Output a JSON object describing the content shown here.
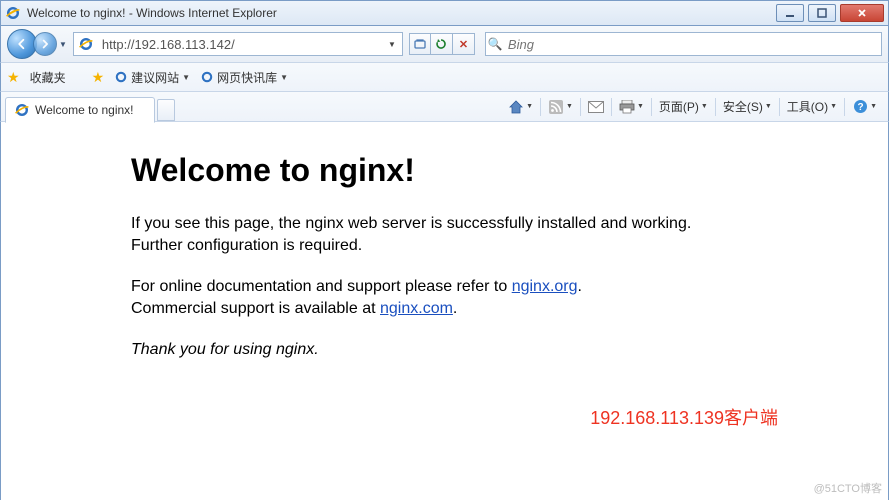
{
  "window": {
    "title": "Welcome to nginx! - Windows Internet Explorer"
  },
  "nav": {
    "url": "http://192.168.113.142/",
    "search_placeholder": "Bing"
  },
  "favorites": {
    "label": "收藏夹",
    "items": [
      {
        "label": "建议网站"
      },
      {
        "label": "网页快讯库"
      }
    ]
  },
  "tab": {
    "title": "Welcome to nginx!"
  },
  "commands": {
    "page": "页面(P)",
    "safety": "安全(S)",
    "tools": "工具(O)"
  },
  "page": {
    "heading": "Welcome to nginx!",
    "p1": "If you see this page, the nginx web server is successfully installed and working. Further configuration is required.",
    "p2a": "For online documentation and support please refer to ",
    "p2link": "nginx.org",
    "p2b": ".",
    "p3a": "Commercial support is available at ",
    "p3link": "nginx.com",
    "p3b": ".",
    "thanks": "Thank you for using nginx."
  },
  "annotation": "192.168.113.139客户端",
  "watermark": "@51CTO博客"
}
